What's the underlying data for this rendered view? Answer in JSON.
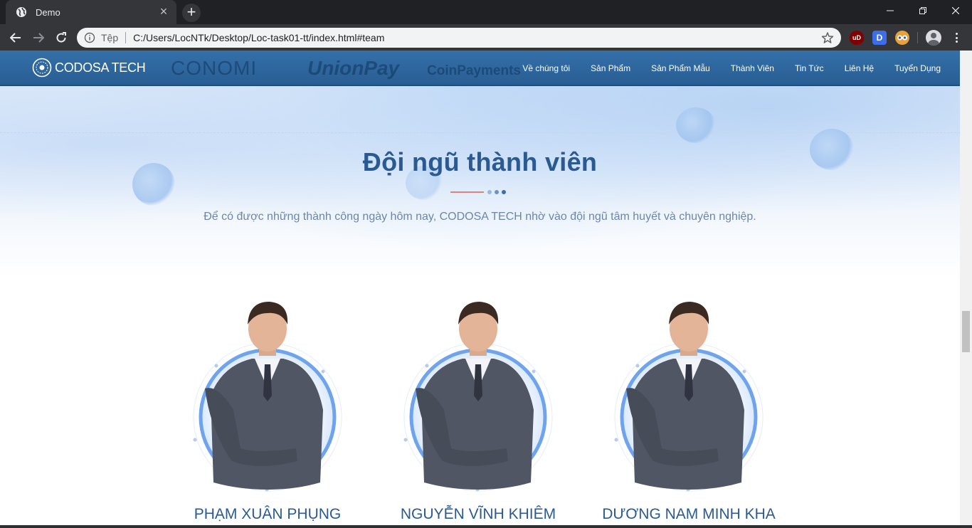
{
  "browser": {
    "tab": {
      "title": "Demo"
    },
    "address_bar": {
      "scheme_label": "Tệp",
      "url": "C:/Users/LocNTk/Desktop/Loc-task01-tt/index.html#team"
    },
    "extensions": {
      "ublock_label": "uD",
      "d_label": "D"
    }
  },
  "site": {
    "brand": "CODOSA TECH",
    "partners": [
      "CONOMI",
      "UnionPay",
      "CoinPayments"
    ],
    "nav": [
      "Về chúng tôi",
      "Sản Phẩm",
      "Sản Phẩm Mẫu",
      "Thành Viên",
      "Tin Tức",
      "Liên Hệ",
      "Tuyển Dụng"
    ]
  },
  "team": {
    "title": "Đội ngũ thành viên",
    "subtitle": "Để có được những thành công ngày hôm nay, CODOSA TECH nhờ vào đội ngũ tâm huyết và chuyên nghiệp.",
    "members": [
      {
        "name": "PHẠM XUÂN PHỤNG"
      },
      {
        "name": "NGUYỄN VĨNH KHIÊM"
      },
      {
        "name": "DƯƠNG NAM MINH KHA"
      }
    ]
  },
  "colors": {
    "accent": "#2a5a92",
    "nav_bg": "#2f6aa3",
    "divider_red": "#d9453b"
  }
}
